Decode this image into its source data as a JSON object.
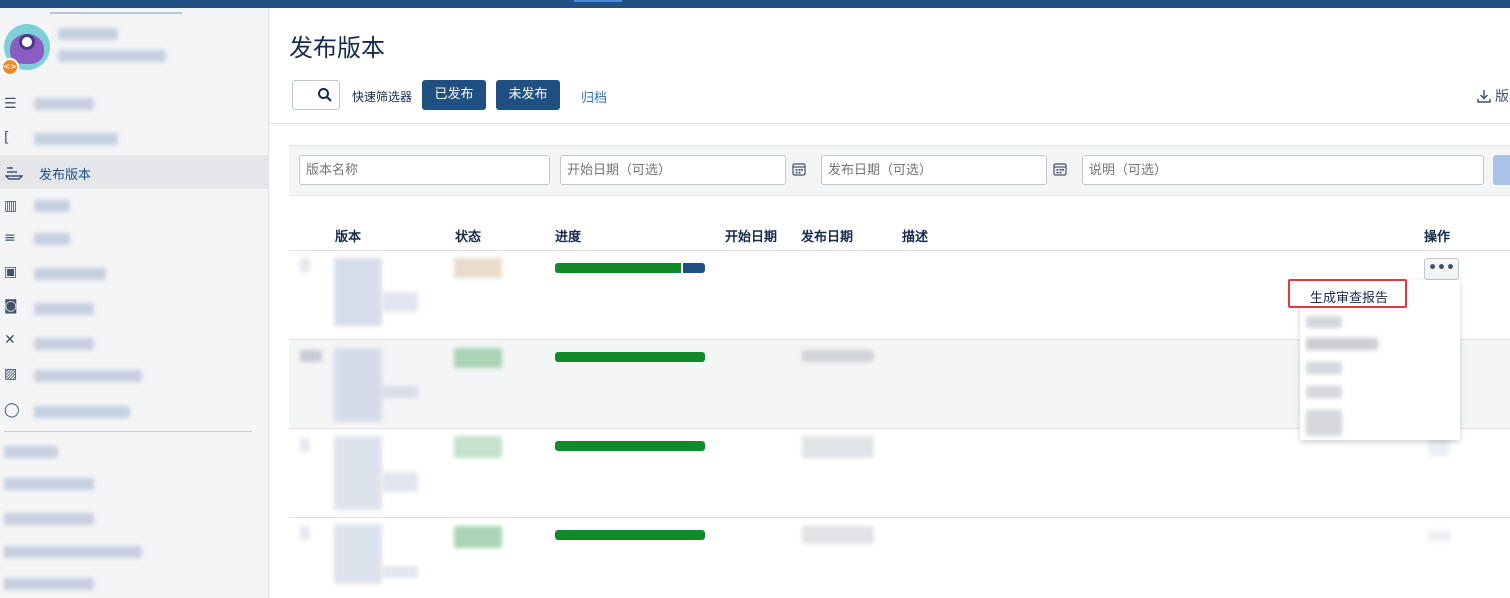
{
  "page": {
    "title": "发布版本"
  },
  "toolbar": {
    "quick_filter_label": "快速筛选器",
    "released_label": "已发布",
    "unreleased_label": "未发布",
    "archived_label": "归档",
    "right_action_label": "版"
  },
  "sidebar": {
    "active_item_label": "发布版本"
  },
  "filters": {
    "name_placeholder": "版本名称",
    "start_date_placeholder": "开始日期（可选）",
    "release_date_placeholder": "发布日期（可选）",
    "description_placeholder": "说明（可选）"
  },
  "table": {
    "columns": [
      "版本",
      "状态",
      "进度",
      "开始日期",
      "发布日期",
      "描述",
      "操作"
    ],
    "rows": [
      {
        "progress_done": 0.85
      },
      {
        "progress_done": 1.0
      },
      {
        "progress_done": 1.0
      },
      {
        "progress_done": 1.0
      }
    ]
  },
  "actions_menu": {
    "more_label": "•••",
    "first_item": "生成审查报告"
  },
  "colors": {
    "brand": "#205081",
    "done": "#14892c",
    "highlight": "#e0393e",
    "link": "#3572b0"
  }
}
